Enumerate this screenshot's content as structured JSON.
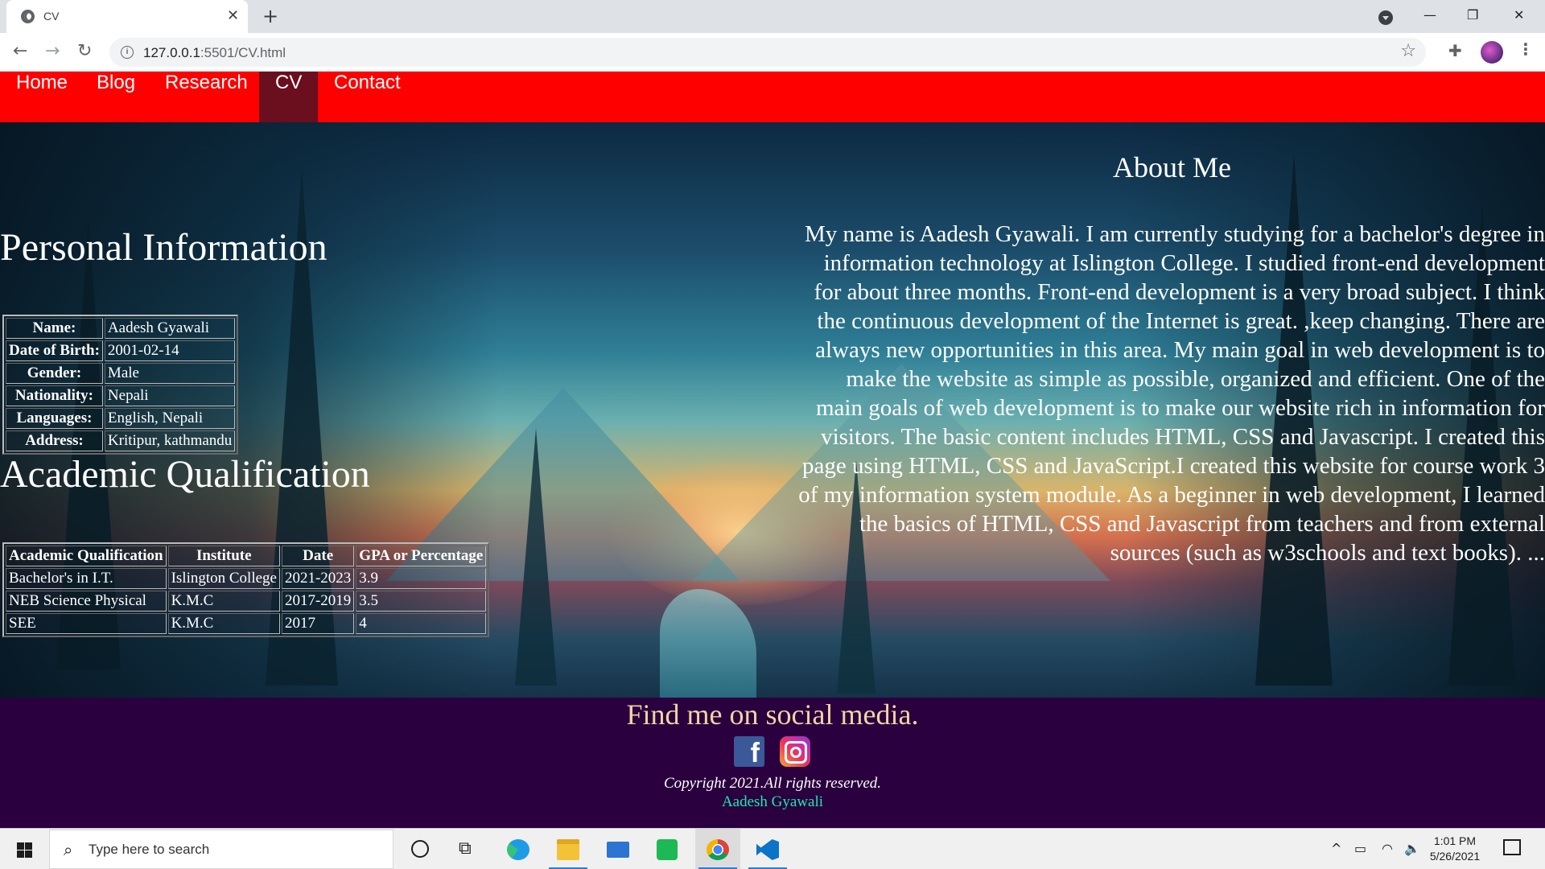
{
  "browser": {
    "tab_title": "CV",
    "tab_close": "✕",
    "new_tab": "+",
    "url_host": "127.0.0.1",
    "url_rest": ":5501/CV.html",
    "window_controls": {
      "minimize": "—",
      "restore": "❐",
      "close": "✕"
    },
    "icons": [
      "tab-favicon-globe-icon",
      "tab-search-icon",
      "back-icon",
      "forward-icon",
      "reload-icon",
      "site-info-icon",
      "bookmark-star-icon",
      "extensions-icon",
      "profile-avatar",
      "menu-kebab-icon"
    ]
  },
  "nav": {
    "items": [
      {
        "label": "Home"
      },
      {
        "label": "Blog"
      },
      {
        "label": "Research"
      },
      {
        "label": "CV",
        "active": true
      },
      {
        "label": "Contact"
      }
    ],
    "bg_color": "#ff0000",
    "active_color": "#6b0e1e"
  },
  "personal": {
    "heading": "Personal Information",
    "rows": [
      {
        "label": "Name:",
        "value": "Aadesh Gyawali"
      },
      {
        "label": "Date of Birth:",
        "value": "2001-02-14"
      },
      {
        "label": "Gender:",
        "value": "Male"
      },
      {
        "label": "Nationality:",
        "value": "Nepali"
      },
      {
        "label": "Languages:",
        "value": "English, Nepali"
      },
      {
        "label": "Address:",
        "value": "Kritipur, kathmandu"
      }
    ]
  },
  "academic": {
    "heading": "Academic Qualification",
    "columns": [
      "Academic Qualification",
      "Institute",
      "Date",
      "GPA or Percentage"
    ],
    "rows": [
      [
        "Bachelor's in I.T.",
        "Islington College",
        "2021-2023",
        "3.9"
      ],
      [
        "NEB Science Physical",
        "K.M.C",
        "2017-2019",
        "3.5"
      ],
      [
        "SEE",
        "K.M.C",
        "2017",
        "4"
      ]
    ]
  },
  "about": {
    "heading": "About Me",
    "text": "My name is Aadesh Gyawali. I am currently studying for a bachelor's degree in information technology at Islington College. I studied front-end development for about three months. Front-end development is a very broad subject. I think the continuous development of the Internet is great. ,keep changing. There are always new opportunities in this area. My main goal in web development is to make the website as simple as possible, organized and efficient. One of the main goals of web development is to make our website rich in information for visitors. The basic content includes HTML, CSS and Javascript. I created this page using HTML, CSS and JavaScript.I created this website for course work 3 of my information system module. As a beginner in web development, I learned the basics of HTML, CSS and Javascript from teachers and from external sources (such as w3schools and text books). ..."
  },
  "footer": {
    "heading": "Find me on social media.",
    "social": [
      "facebook-icon",
      "instagram-icon"
    ],
    "facebook_glyph": "f",
    "copyright": "Copyright 2021.All rights reserved.",
    "author": "Aadesh Gyawali",
    "bg_color": "#2a003e"
  },
  "taskbar": {
    "search_placeholder": "Type here to search",
    "time": "1:01 PM",
    "date": "5/26/2021",
    "pinned": [
      "cortana-icon",
      "task-view-icon",
      "edge-icon",
      "file-explorer-icon",
      "mail-icon",
      "spotify-icon",
      "chrome-icon",
      "vscode-icon"
    ]
  }
}
